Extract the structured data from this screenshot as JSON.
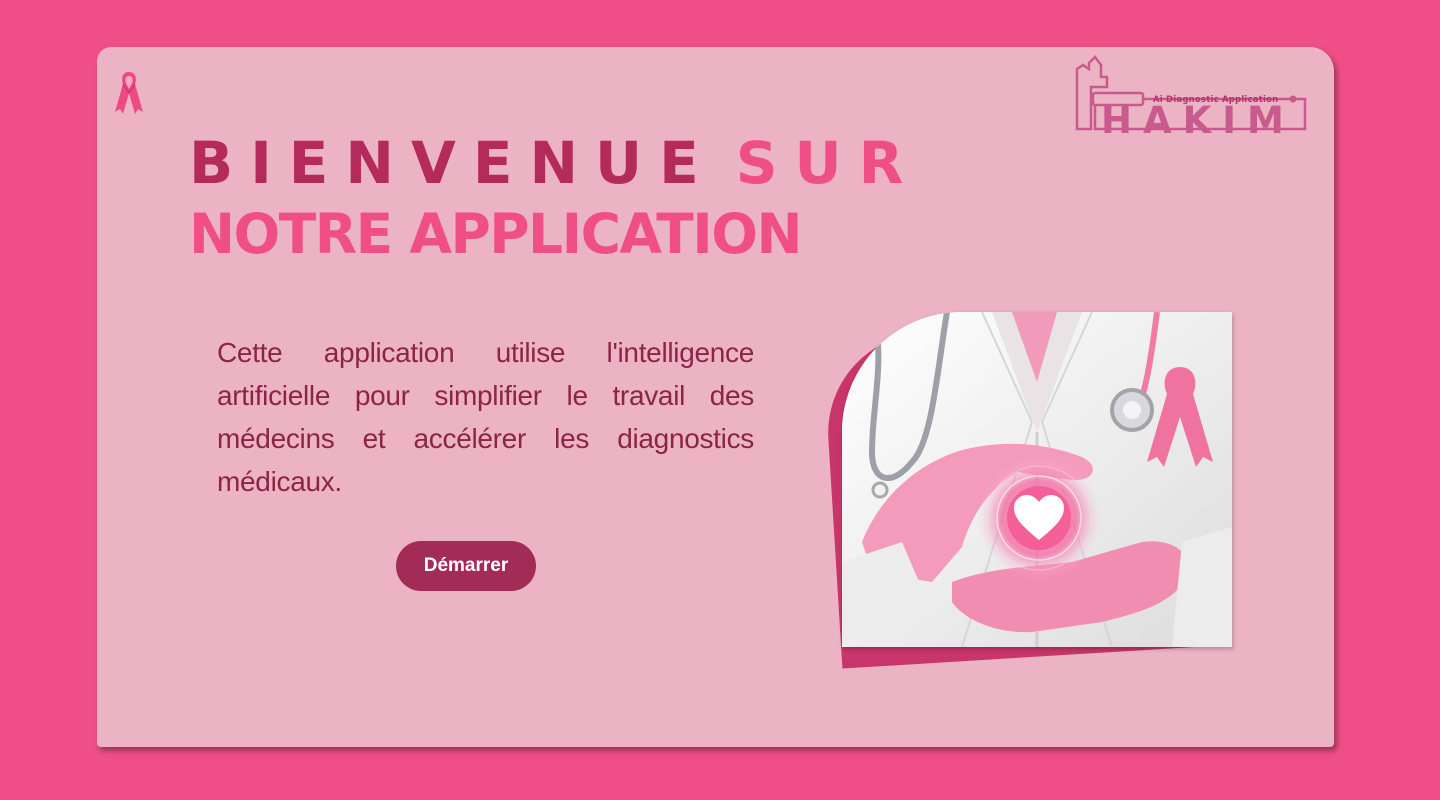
{
  "brand": {
    "logo_name": "HAKIM",
    "logo_subtitle": "Ai Diagnostic Application"
  },
  "hero": {
    "title_line1_part1": "BIENVENUE",
    "title_line1_part2": "SUR",
    "title_line2": "NOTRE APPLICATION",
    "description": "Cette application utilise l'intelligence artificielle pour simplifier le travail des médecins et accélérer les diagnostics médicaux.",
    "start_button": "Démarrer"
  },
  "icons": {
    "ribbon": "pink-ribbon-icon",
    "heart": "heart-icon"
  },
  "colors": {
    "page_background": "#ef4f86",
    "card_background": "#ebb3c4",
    "title_dark": "#b32a5b",
    "title_bright": "#ef4f86",
    "description_text": "#8c2448",
    "button_background": "#a22c55"
  }
}
